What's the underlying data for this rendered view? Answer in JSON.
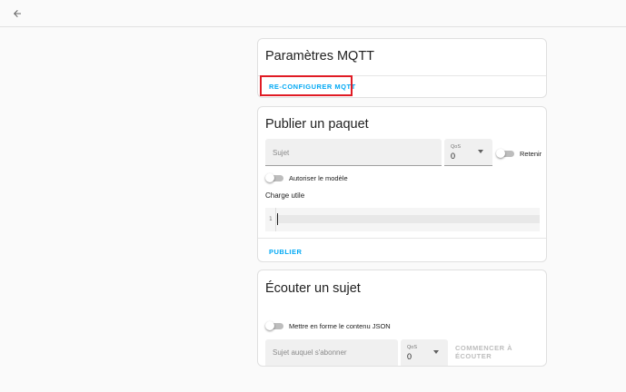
{
  "toolbar": {
    "back_icon": "arrow-left-icon"
  },
  "mqtt_settings": {
    "title": "Paramètres MQTT",
    "reconfigure_label": "RE-CONFIGURER MQTT"
  },
  "publish": {
    "title": "Publier un paquet",
    "topic_placeholder": "Sujet",
    "qos_label": "QoS",
    "qos_value": "0",
    "retain_label": "Retenir",
    "template_label": "Autoriser le modèle",
    "payload_label": "Charge utile",
    "line_number": "1",
    "publish_label": "PUBLIER"
  },
  "listen": {
    "title": "Écouter un sujet",
    "format_json_label": "Mettre en forme le contenu JSON",
    "subscribe_placeholder": "Sujet auquel s'abonner",
    "qos_label": "QoS",
    "qos_value": "0",
    "start_label": "COMMENCER À ÉCOUTER"
  },
  "colors": {
    "accent": "#03a9f4",
    "highlight": "#e01b24",
    "background": "#fafafa"
  }
}
